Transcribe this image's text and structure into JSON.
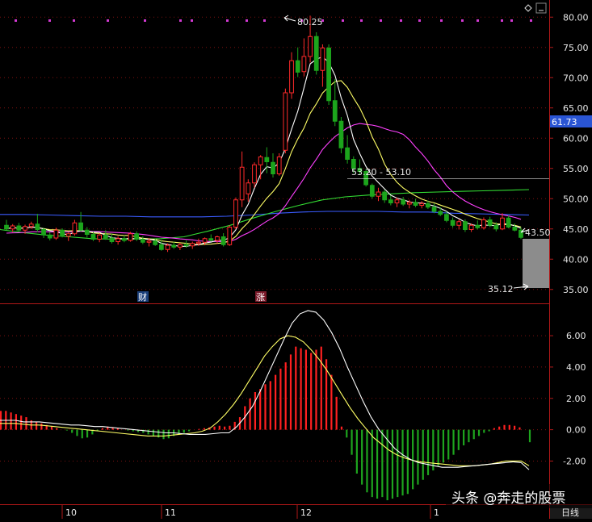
{
  "chart_data": [
    {
      "type": "candlestick",
      "panel": "price",
      "y_ticks": [
        "80.00",
        "75.00",
        "70.00",
        "65.00",
        "60.00",
        "55.00",
        "50.00",
        "45.00",
        "40.00",
        "35.00"
      ],
      "ylim": [
        33.5,
        81.5
      ],
      "current_price": "61.73",
      "annotations": {
        "high": "80.25",
        "range": "53.20 - 53.10",
        "last": "43.50",
        "low": "35.12"
      },
      "markers": [
        "财",
        "涨"
      ],
      "colors": {
        "up": "#ff2a2a",
        "down": "#1ca51c",
        "ma5": "#ffffff",
        "ma10": "#ffff66",
        "ma20": "#ff40ff",
        "ma60": "#33dd33",
        "ma120": "#3a5cff"
      },
      "candles": [
        [
          45.6,
          46.5,
          44.8,
          45.0
        ],
        [
          45.0,
          45.8,
          44.5,
          45.5
        ],
        [
          45.5,
          46.0,
          44.6,
          44.8
        ],
        [
          44.8,
          45.7,
          44.2,
          45.4
        ],
        [
          45.4,
          46.2,
          45.0,
          45.8
        ],
        [
          45.8,
          47.5,
          44.5,
          44.9
        ],
        [
          44.9,
          45.2,
          43.5,
          44.0
        ],
        [
          44.0,
          44.5,
          43.1,
          43.5
        ],
        [
          43.5,
          45.2,
          43.2,
          44.8
        ],
        [
          44.8,
          45.1,
          43.6,
          43.8
        ],
        [
          43.8,
          44.4,
          43.0,
          44.2
        ],
        [
          44.2,
          46.5,
          43.9,
          46.0
        ],
        [
          46.0,
          47.8,
          44.6,
          44.8
        ],
        [
          44.8,
          45.3,
          43.6,
          44.1
        ],
        [
          44.1,
          44.5,
          43.0,
          43.3
        ],
        [
          43.3,
          44.3,
          42.8,
          44.0
        ],
        [
          44.0,
          44.8,
          43.2,
          43.5
        ],
        [
          43.5,
          44.2,
          42.6,
          42.9
        ],
        [
          42.9,
          43.8,
          42.4,
          43.4
        ],
        [
          43.4,
          44.0,
          42.8,
          43.1
        ],
        [
          43.1,
          44.5,
          42.9,
          44.2
        ],
        [
          44.2,
          44.6,
          43.0,
          43.3
        ],
        [
          43.3,
          43.8,
          42.5,
          42.8
        ],
        [
          42.8,
          43.5,
          42.1,
          43.0
        ],
        [
          43.0,
          43.4,
          42.2,
          42.4
        ],
        [
          42.4,
          43.2,
          41.4,
          41.6
        ],
        [
          41.6,
          42.6,
          41.2,
          42.3
        ],
        [
          42.3,
          42.9,
          41.7,
          42.0
        ],
        [
          42.0,
          42.7,
          41.5,
          42.4
        ],
        [
          42.4,
          43.1,
          41.9,
          42.2
        ],
        [
          42.2,
          42.9,
          41.7,
          42.6
        ],
        [
          42.6,
          43.4,
          42.2,
          42.8
        ],
        [
          42.8,
          43.6,
          42.3,
          43.4
        ],
        [
          43.4,
          44.1,
          42.9,
          43.1
        ],
        [
          43.1,
          43.9,
          42.6,
          43.7
        ],
        [
          43.7,
          44.3,
          42.1,
          42.4
        ],
        [
          42.4,
          45.6,
          42.2,
          45.3
        ],
        [
          45.3,
          50.2,
          45.0,
          49.8
        ],
        [
          49.8,
          57.8,
          48.6,
          55.2
        ],
        [
          50.8,
          53.2,
          49.5,
          52.6
        ],
        [
          52.6,
          56.0,
          51.8,
          55.6
        ],
        [
          55.6,
          57.2,
          53.2,
          56.9
        ],
        [
          56.8,
          58.5,
          54.2,
          56.1
        ],
        [
          56.0,
          57.5,
          53.5,
          54.1
        ],
        [
          54.1,
          57.5,
          53.8,
          56.9
        ],
        [
          58.0,
          68.2,
          57.5,
          67.5
        ],
        [
          67.5,
          74.2,
          66.5,
          72.8
        ],
        [
          72.8,
          75.0,
          70.1,
          70.9
        ],
        [
          71.0,
          76.5,
          70.2,
          73.5
        ],
        [
          73.5,
          80.25,
          72.5,
          76.8
        ],
        [
          76.8,
          77.5,
          70.5,
          71.2
        ],
        [
          71.2,
          75.5,
          68.5,
          74.9
        ],
        [
          74.9,
          75.5,
          65.5,
          66.2
        ],
        [
          66.2,
          69.8,
          62.0,
          62.8
        ],
        [
          62.8,
          63.5,
          57.5,
          58.4
        ],
        [
          58.4,
          60.5,
          55.8,
          56.5
        ],
        [
          56.5,
          57.0,
          54.2,
          55.0
        ],
        [
          55.0,
          56.5,
          53.9,
          54.5
        ],
        [
          54.5,
          54.9,
          52.0,
          52.3
        ],
        [
          52.2,
          52.5,
          50.0,
          50.4
        ],
        [
          50.4,
          51.8,
          49.6,
          51.1
        ],
        [
          51.1,
          51.5,
          49.3,
          49.8
        ],
        [
          49.8,
          50.5,
          48.9,
          49.3
        ],
        [
          49.3,
          50.2,
          48.6,
          49.8
        ],
        [
          49.8,
          50.3,
          48.8,
          49.1
        ],
        [
          49.1,
          49.8,
          48.4,
          49.4
        ],
        [
          49.4,
          50.0,
          48.6,
          48.9
        ],
        [
          48.9,
          49.6,
          48.4,
          49.2
        ],
        [
          49.2,
          49.7,
          48.3,
          48.6
        ],
        [
          48.6,
          49.2,
          47.6,
          47.9
        ],
        [
          47.9,
          48.6,
          47.1,
          47.4
        ],
        [
          47.4,
          47.9,
          46.1,
          46.4
        ],
        [
          46.4,
          46.9,
          45.2,
          45.6
        ],
        [
          45.6,
          46.6,
          44.9,
          46.2
        ],
        [
          46.2,
          46.6,
          44.5,
          44.9
        ],
        [
          44.9,
          45.9,
          44.5,
          45.6
        ],
        [
          45.6,
          46.4,
          44.9,
          45.2
        ],
        [
          45.2,
          46.9,
          44.9,
          46.5
        ],
        [
          46.5,
          47.0,
          45.3,
          45.6
        ],
        [
          45.6,
          46.1,
          44.6,
          45.0
        ],
        [
          45.0,
          47.6,
          44.8,
          46.8
        ],
        [
          46.8,
          47.2,
          45.1,
          45.3
        ],
        [
          45.3,
          45.9,
          44.6,
          44.8
        ],
        [
          44.8,
          45.3,
          43.3,
          43.6
        ]
      ],
      "moving_averages": {
        "ma20_start": 44.3,
        "ma60": [
          44.9,
          44.4,
          44.0,
          43.7,
          43.4,
          43.3,
          43.3,
          43.4,
          43.7,
          44.6,
          45.6,
          46.8,
          47.9,
          48.9,
          49.8,
          50.3,
          50.6,
          50.8,
          51.0,
          51.1,
          51.2,
          51.3,
          51.4,
          51.5
        ],
        "ma120": [
          47.4,
          47.4,
          47.3,
          47.2,
          47.1,
          47.1,
          47.0,
          47.0,
          47.0,
          47.1,
          47.3,
          47.6,
          47.8,
          47.9,
          47.9,
          47.9,
          47.8,
          47.8,
          47.6,
          47.5,
          47.4,
          47.3
        ]
      }
    },
    {
      "type": "macd",
      "panel": "indicator",
      "y_ticks": [
        "6.00",
        "4.00",
        "2.00",
        "0.00",
        "-2.00"
      ],
      "ylim": [
        -4.5,
        7.6
      ],
      "histogram": [
        1.2,
        1.2,
        1.1,
        1.0,
        0.9,
        0.8,
        0.6,
        0.5,
        0.4,
        0.3,
        0.2,
        0.1,
        0.0,
        -0.05,
        -0.2,
        -0.4,
        -0.55,
        -0.5,
        -0.3,
        -0.1,
        0.1,
        0.2,
        0.15,
        0.1,
        0.0,
        -0.05,
        -0.1,
        -0.15,
        -0.2,
        -0.3,
        -0.4,
        -0.5,
        -0.6,
        -0.55,
        -0.4,
        -0.3,
        -0.2,
        -0.1,
        0.0,
        0.05,
        0.1,
        0.15,
        0.2,
        0.25,
        0.2,
        0.25,
        0.5,
        0.8,
        1.5,
        2.0,
        2.4,
        2.6,
        2.9,
        3.1,
        3.5,
        3.9,
        4.3,
        4.8,
        5.3,
        5.2,
        5.1,
        4.9,
        5.1,
        5.3,
        4.5,
        3.5,
        2.1,
        0.2,
        -0.5,
        -1.6,
        -2.8,
        -3.5,
        -4.0,
        -4.3,
        -4.4,
        -4.3,
        -4.5,
        -4.4,
        -4.3,
        -4.2,
        -4.1,
        -3.8,
        -3.5,
        -3.2,
        -2.9,
        -2.6,
        -2.3,
        -2.1,
        -1.9,
        -1.6,
        -1.3,
        -1.0,
        -0.8,
        -0.6,
        -0.4,
        -0.2,
        -0.1,
        0.1,
        0.2,
        0.3,
        0.3,
        0.25,
        0.15,
        0.0,
        -0.8
      ],
      "dif": [
        0.6,
        0.6,
        0.6,
        0.5,
        0.5,
        0.5,
        0.45,
        0.4,
        0.35,
        0.3,
        0.3,
        0.25,
        0.2,
        0.2,
        0.15,
        0.1,
        0.05,
        0.0,
        -0.05,
        -0.1,
        -0.15,
        -0.2,
        -0.2,
        -0.25,
        -0.3,
        -0.3,
        -0.3,
        -0.25,
        -0.2,
        -0.2,
        0.2,
        0.8,
        1.5,
        2.5,
        3.6,
        4.7,
        5.8,
        6.8,
        7.4,
        7.6,
        7.5,
        7.0,
        6.2,
        5.2,
        4.0,
        2.9,
        1.8,
        0.8,
        0.0,
        -0.6,
        -1.2,
        -1.6,
        -1.9,
        -2.1,
        -2.2,
        -2.3,
        -2.4,
        -2.4,
        -2.4,
        -2.35,
        -2.3,
        -2.25,
        -2.2,
        -2.15,
        -2.1,
        -2.05,
        -2.1,
        -2.55
      ],
      "dea": [
        0.4,
        0.4,
        0.4,
        0.35,
        0.3,
        0.3,
        0.25,
        0.2,
        0.15,
        0.1,
        0.05,
        0.0,
        -0.05,
        -0.1,
        -0.15,
        -0.2,
        -0.25,
        -0.3,
        -0.35,
        -0.4,
        -0.4,
        -0.4,
        -0.35,
        -0.3,
        -0.25,
        -0.2,
        -0.1,
        0.1,
        0.5,
        1.0,
        1.6,
        2.3,
        3.1,
        3.9,
        4.7,
        5.3,
        5.8,
        6.0,
        5.9,
        5.6,
        5.1,
        4.5,
        3.8,
        3.0,
        2.2,
        1.4,
        0.7,
        0.1,
        -0.5,
        -0.9,
        -1.3,
        -1.6,
        -1.8,
        -1.95,
        -2.05,
        -2.1,
        -2.15,
        -2.2,
        -2.25,
        -2.3,
        -2.3,
        -2.3,
        -2.25,
        -2.2,
        -2.1,
        -2.0,
        -2.0,
        -2.0,
        -2.3
      ]
    }
  ],
  "x_ticks": [
    "10",
    "11",
    "12",
    "1"
  ],
  "period_label": "日线",
  "watermark": "头条 @奔走的股票",
  "window_icons": [
    "diamond-icon",
    "minimize-icon"
  ]
}
